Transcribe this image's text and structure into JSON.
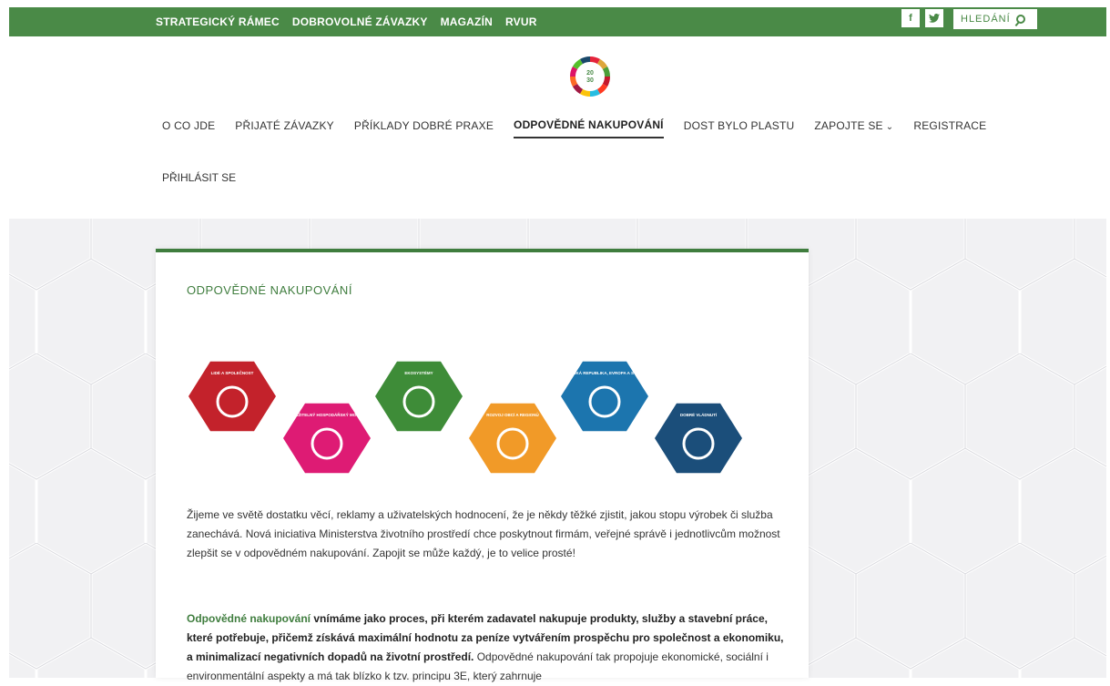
{
  "topbar": {
    "links": [
      "STRATEGICKÝ RÁMEC",
      "DOBROVOLNÉ ZÁVAZKY",
      "MAGAZÍN",
      "RVUR"
    ],
    "social": {
      "facebook": "f",
      "twitter": "t"
    },
    "search_label": "HLEDÁNÍ",
    "color": "#4a8a47"
  },
  "logo": {
    "text_top": "20",
    "text_bottom": "30"
  },
  "nav": {
    "items": [
      "O CO JDE",
      "PŘIJATÉ ZÁVAZKY",
      "PŘÍKLADY DOBRÉ PRAXE",
      "ODPOVĚDNÉ NAKUPOVÁNÍ",
      "DOST BYLO PLASTU",
      "ZAPOJTE SE",
      "REGISTRACE"
    ],
    "active": "ODPOVĚDNÉ NAKUPOVÁNÍ",
    "login": "PŘIHLÁSIT SE"
  },
  "article": {
    "title": "ODPOVĚDNÉ NAKUPOVÁNÍ",
    "hexes": [
      {
        "label": "LIDÉ A SPOLEČNOST",
        "color": "#c3222b"
      },
      {
        "label": "UDRŽITELNÝ HOSPODÁŘSKÝ MODEL",
        "color": "#de1b74"
      },
      {
        "label": "EKOSYSTÉMY",
        "color": "#3e8c38"
      },
      {
        "label": "ROZVOJ OBCÍ A REGIONŮ",
        "color": "#f19a28"
      },
      {
        "label": "ČESKÁ REPUBLIKA, EVROPA A SVĚT",
        "color": "#1c75ae"
      },
      {
        "label": "DOBRÉ VLÁDNUTÍ",
        "color": "#1b4e7a"
      }
    ],
    "para1": "Žijeme ve světě dostatku věcí, reklamy a uživatelských hodnocení, že je někdy těžké zjistit, jakou stopu výrobek či služba zanechává. Nová iniciativa Ministerstva životního prostředí chce poskytnout firmám, veřejné správě i jednotlivcům možnost zlepšit se v odpovědném nakupování. Zapojit se může každý, je to velice prosté!",
    "para2_highlight": "Odpovědné nakupování",
    "para2_bold": " vnímáme jako proces, při kterém zadavatel nakupuje produkty, služby a stavební práce, které potřebuje, přičemž získává maximální hodnotu za peníze vytvářením prospěchu pro společnost a ekonomiku, a minimalizací negativních dopadů na životní prostředí.",
    "para2_rest": " Odpovědné nakupování tak propojuje ekonomické, sociální i environmentální aspekty a má tak blízko k tzv. principu 3E, který zahrnuje"
  }
}
